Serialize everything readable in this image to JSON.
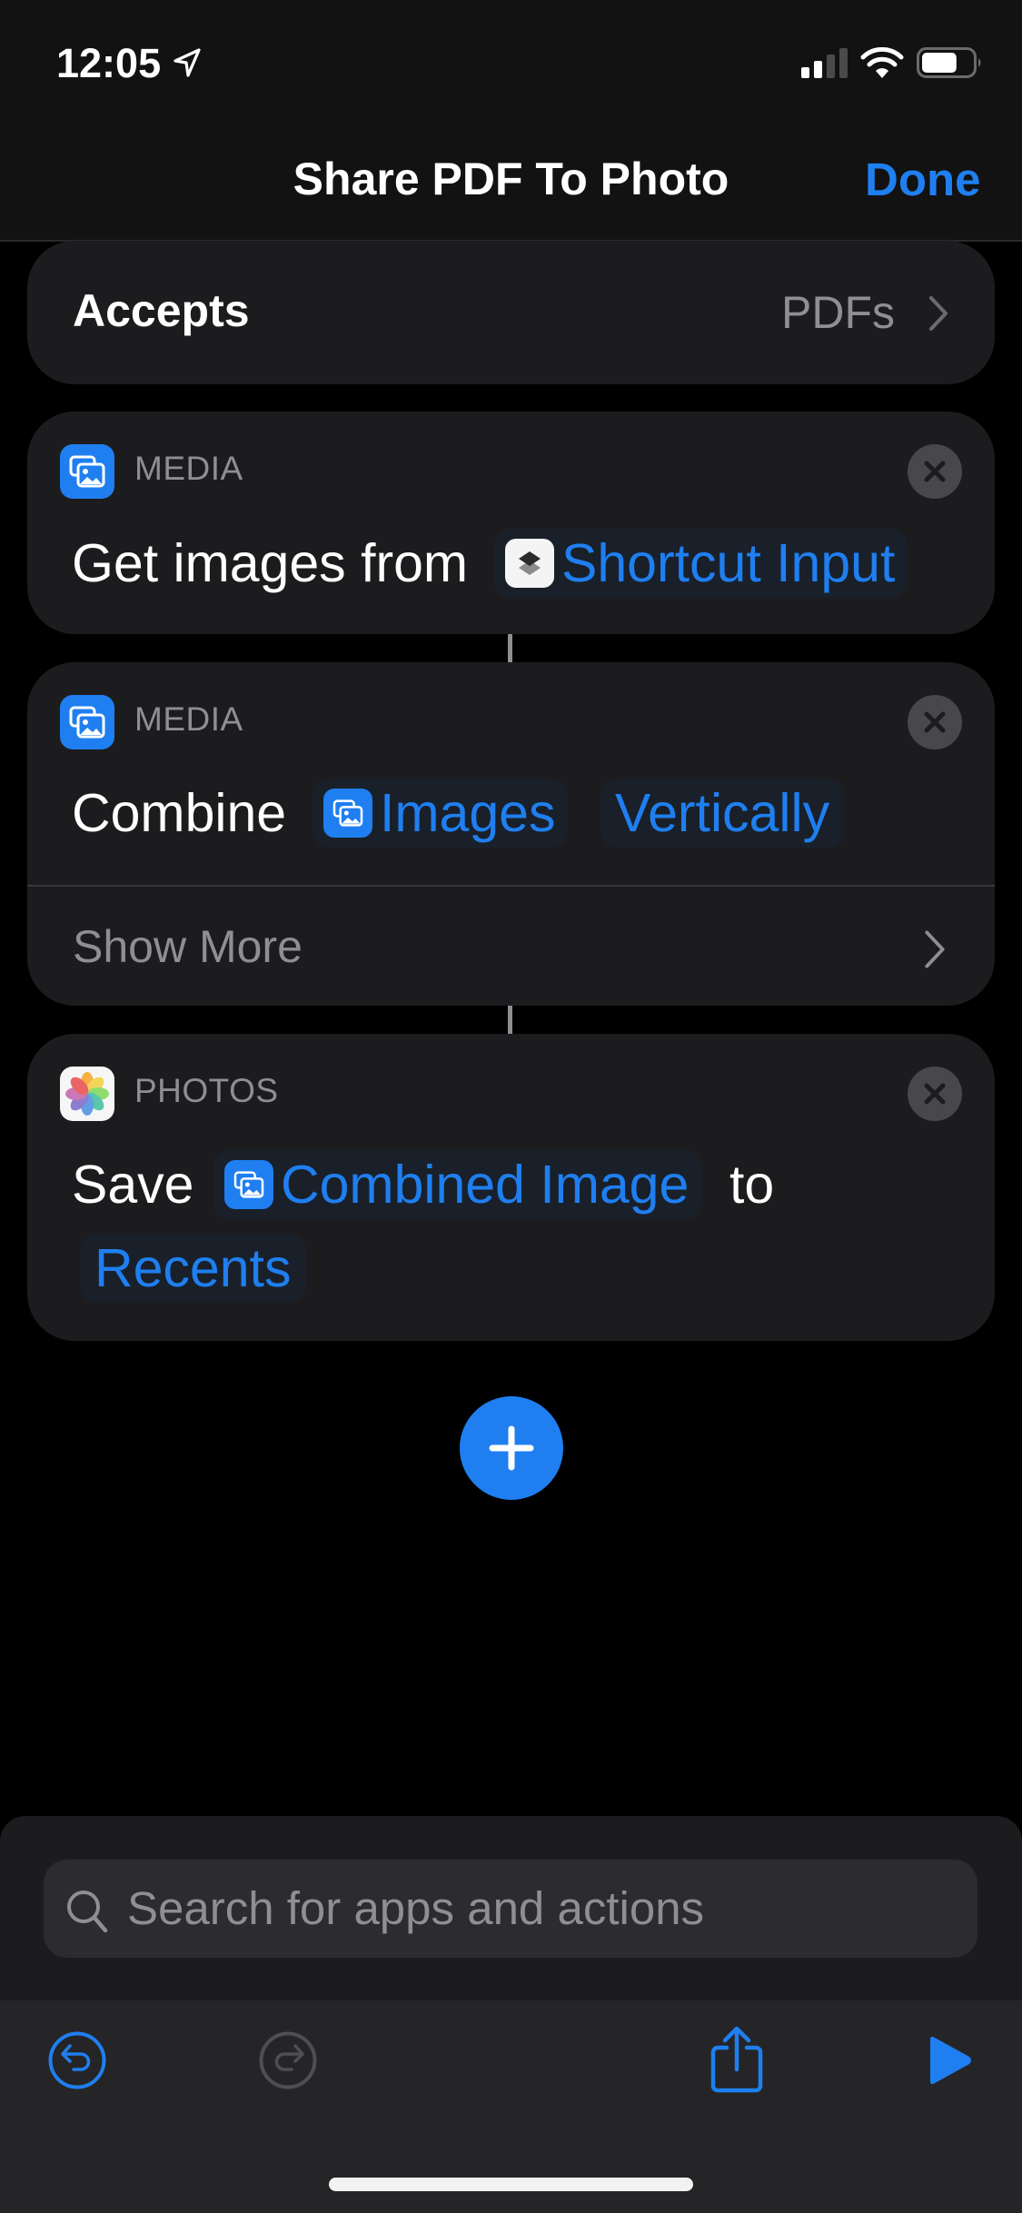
{
  "status_bar": {
    "time": "12:05",
    "location_icon": "location-arrow-icon",
    "signal_bars_active": 2,
    "signal_bars_total": 4,
    "battery_level": 0.7
  },
  "nav": {
    "title": "Share PDF To Photo",
    "done_label": "Done"
  },
  "accepts": {
    "label": "Accepts",
    "value": "PDFs"
  },
  "actions": [
    {
      "category": "MEDIA",
      "icon": "media-images-icon",
      "text_before": "Get images from",
      "token": {
        "label": "Shortcut Input",
        "icon": "shortcuts-icon"
      }
    },
    {
      "category": "MEDIA",
      "icon": "media-images-icon",
      "text_before": "Combine",
      "token": {
        "label": "Images",
        "icon": "media-images-icon"
      },
      "token2": {
        "label": "Vertically"
      },
      "show_more": "Show More"
    },
    {
      "category": "PHOTOS",
      "icon": "photos-app-icon",
      "text_before": "Save",
      "token": {
        "label": "Combined Image",
        "icon": "media-images-icon"
      },
      "text_after": "to",
      "token2": {
        "label": "Recents"
      }
    }
  ],
  "search": {
    "placeholder": "Search for apps and actions"
  },
  "toolbar": {
    "undo": "undo-icon",
    "redo": "redo-icon",
    "share": "share-icon",
    "play": "play-icon"
  },
  "colors": {
    "accent": "#1f7ff0",
    "card": "#1c1c1e",
    "secondary_text": "#8e8e93"
  }
}
